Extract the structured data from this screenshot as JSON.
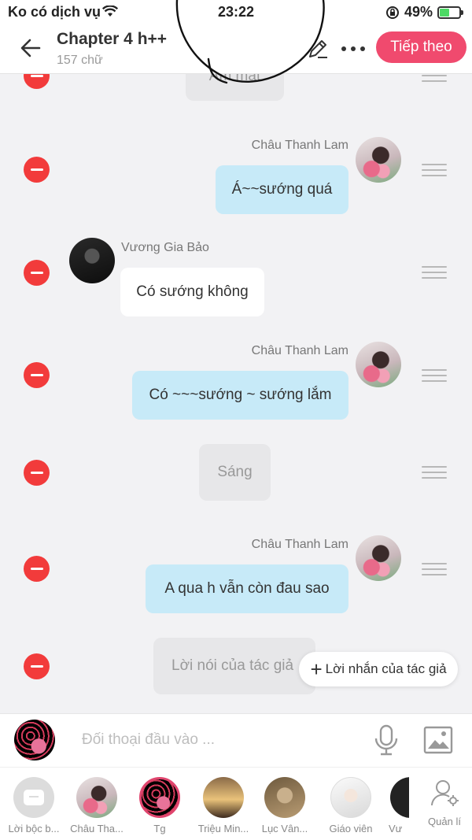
{
  "status_bar": {
    "carrier": "Ko có dịch vụ",
    "time": "23:22",
    "battery_percent": "49%",
    "battery_level": 0.49
  },
  "header": {
    "title": "Chapter 4 h++",
    "word_count": "157 chữ",
    "next_label": "Tiếp theo"
  },
  "messages": [
    {
      "type": "narration",
      "text": "Ấm mặt"
    },
    {
      "type": "right",
      "name": "Châu Thanh Lam",
      "text": "Á~~sướng quá"
    },
    {
      "type": "left",
      "name": "Vương Gia Bảo",
      "text": "Có sướng không"
    },
    {
      "type": "right",
      "name": "Châu Thanh Lam",
      "text": "Có ~~~sướng ~ sướng lắm"
    },
    {
      "type": "narration",
      "text": "Sáng"
    },
    {
      "type": "right",
      "name": "Châu Thanh Lam",
      "text": "A qua h vẫn còn đau sao"
    },
    {
      "type": "narration",
      "text": "Lời nói của tác giả"
    }
  ],
  "author_note_button": {
    "plus": "+",
    "label": "Lời nhắn của tác giả"
  },
  "input": {
    "placeholder": "Đối thoại đầu vào ..."
  },
  "characters": [
    {
      "label": "Lời bộc b..."
    },
    {
      "label": "Châu Tha..."
    },
    {
      "label": "Tg"
    },
    {
      "label": "Triệu Min..."
    },
    {
      "label": "Lục Vân..."
    },
    {
      "label": "Giáo viên"
    },
    {
      "label": "Vư"
    }
  ],
  "manage_label": "Quản lí",
  "colors": {
    "accent": "#f04a6e",
    "bubble_blue": "#c7eaf8",
    "delete_red": "#f23b3b"
  },
  "icons": [
    "back-arrow-icon",
    "pencil-icon",
    "more-icon",
    "minus-icon",
    "drag-handle-icon",
    "microphone-icon",
    "image-icon",
    "person-settings-icon",
    "wifi-icon",
    "battery-icon"
  ]
}
